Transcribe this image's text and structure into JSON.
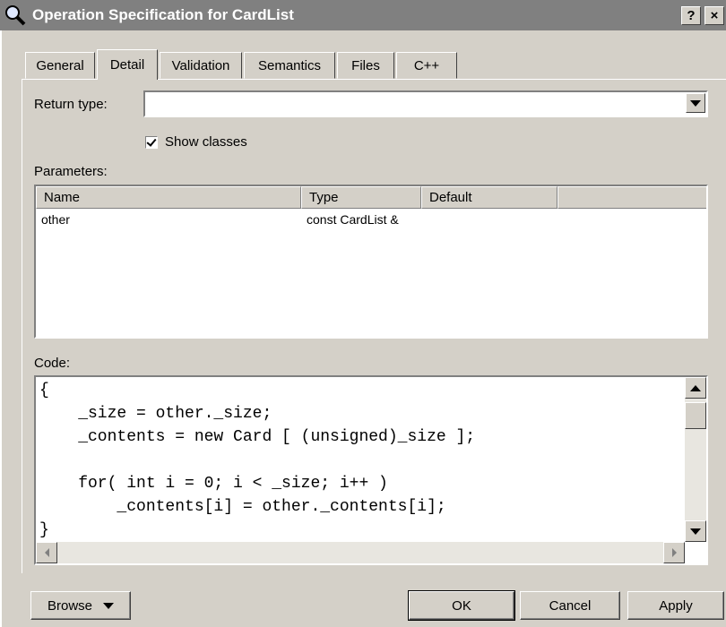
{
  "window": {
    "title": "Operation Specification for CardList",
    "help_label": "?",
    "close_label": "×"
  },
  "tabs": [
    {
      "label": "General"
    },
    {
      "label": "Detail"
    },
    {
      "label": "Validation"
    },
    {
      "label": "Semantics"
    },
    {
      "label": "Files"
    },
    {
      "label": "C++"
    }
  ],
  "active_tab": "Detail",
  "return_type": {
    "label": "Return type:",
    "value": ""
  },
  "show_classes": {
    "label": "Show classes",
    "checked": true
  },
  "parameters": {
    "label": "Parameters:",
    "columns": [
      "Name",
      "Type",
      "Default"
    ],
    "rows": [
      {
        "name": "other",
        "type": "const CardList &",
        "default": ""
      }
    ]
  },
  "code": {
    "label": "Code:",
    "text": "{\n    _size = other._size;\n    _contents = new Card [ (unsigned)_size ];\n\n    for( int i = 0; i < _size; i++ )\n        _contents[i] = other._contents[i];\n}"
  },
  "buttons": {
    "browse": "Browse",
    "ok": "OK",
    "cancel": "Cancel",
    "apply": "Apply"
  },
  "icons": {
    "app": "magnifier-icon",
    "dropdown": "chevron-down-icon"
  }
}
